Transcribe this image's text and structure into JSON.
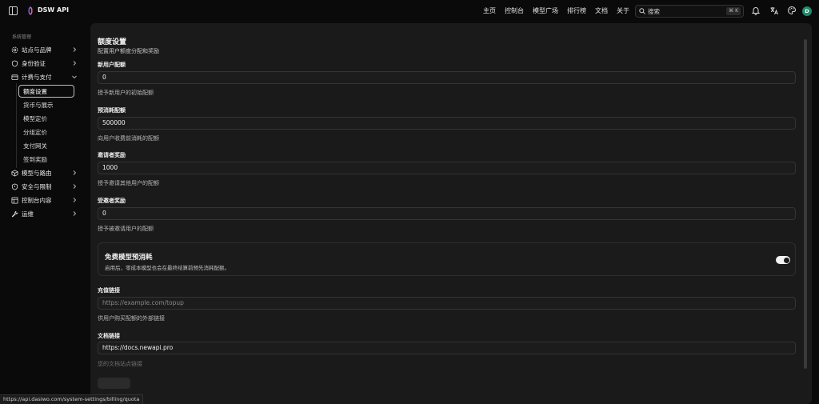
{
  "app": {
    "title": "DSW API"
  },
  "nav": {
    "items": [
      "主页",
      "控制台",
      "模型广场",
      "排行榜",
      "文档",
      "关于"
    ]
  },
  "search": {
    "placeholder": "搜索",
    "shortcut": "⌘ K"
  },
  "user": {
    "avatar_initial": "D",
    "avatar_color": "#1f8a6b"
  },
  "sidebar": {
    "group_label": "系统管理",
    "items": [
      {
        "label": "站点与品牌",
        "icon": "settings-icon"
      },
      {
        "label": "身份验证",
        "icon": "shield-icon"
      },
      {
        "label": "计费与支付",
        "icon": "wallet-icon"
      },
      {
        "label": "模型与路由",
        "icon": "box-icon"
      },
      {
        "label": "安全与限制",
        "icon": "shield-alert-icon"
      },
      {
        "label": "控制台内容",
        "icon": "layout-icon"
      },
      {
        "label": "运维",
        "icon": "wrench-icon"
      }
    ],
    "sub_items": [
      "额度设置",
      "货币与展示",
      "模型定价",
      "分组定价",
      "支付网关",
      "签到奖励"
    ],
    "active_sub": "额度设置"
  },
  "main": {
    "title": "额度设置",
    "description": "配置用户额度分配和奖励",
    "fields": [
      {
        "label": "新用户配额",
        "value": "0",
        "help": "授予新用户的初始配额"
      },
      {
        "label": "预消耗配额",
        "value": "500000",
        "help": "向用户收费前消耗的配额"
      },
      {
        "label": "邀请者奖励",
        "value": "1000",
        "help": "授予邀请其他用户的配额"
      },
      {
        "label": "受邀者奖励",
        "value": "0",
        "help": "授予被邀请用户的配额"
      }
    ],
    "toggle_card": {
      "title": "免费模型预消耗",
      "description": "启用后，零成本模型也会在最终结算前预先消耗配额。",
      "enabled": true
    },
    "fields2": [
      {
        "label": "充值链接",
        "placeholder": "https://example.com/topup",
        "value": "",
        "help": "供用户购买配额的外部链接"
      },
      {
        "label": "文档链接",
        "placeholder": "",
        "value": "https://docs.newapi.pro",
        "help": "您的文档站点链接"
      }
    ]
  },
  "status_url": "https://api.dasiwo.com/system-settings/billing/quota"
}
